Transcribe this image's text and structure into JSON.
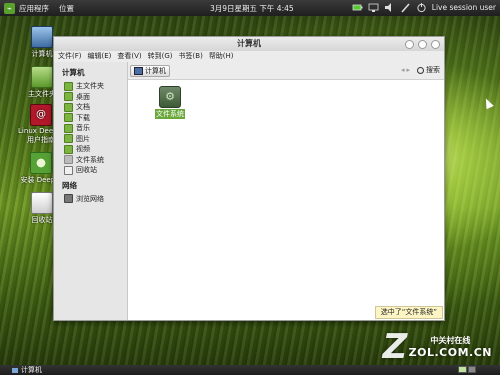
{
  "top_panel": {
    "menus": [
      "应用程序",
      "位置"
    ],
    "clock": "3月9日星期五 下午 4:45",
    "user": "Live session user"
  },
  "desktop": {
    "icons": [
      {
        "name": "computer",
        "label": "计算机"
      },
      {
        "name": "home",
        "label": "主文件夹"
      },
      {
        "name": "linux-deepin",
        "label": "Linux Deepin 用户指南"
      },
      {
        "name": "install",
        "label": "安装 Deepin"
      },
      {
        "name": "trash",
        "label": "回收站"
      }
    ]
  },
  "window": {
    "title": "计算机",
    "menus": [
      "文件(F)",
      "编辑(E)",
      "查看(V)",
      "转到(G)",
      "书签(B)",
      "帮助(H)"
    ],
    "location": "计算机",
    "search_label": "搜索",
    "sidebar": {
      "sections": [
        {
          "title": "计算机",
          "items": [
            "主文件夹",
            "桌面",
            "文档",
            "下载",
            "音乐",
            "图片",
            "视频",
            "文件系统",
            "回收站"
          ]
        },
        {
          "title": "网络",
          "items": [
            "浏览网络"
          ]
        }
      ]
    },
    "files": [
      {
        "label": "文件系统",
        "selected": true
      }
    ],
    "status": "选中了“文件系统”"
  },
  "bottom_panel": {
    "task": "计算机",
    "workspaces": 3
  },
  "watermark": {
    "cn": "中关村在线",
    "en": "ZOL.COM.CN"
  }
}
